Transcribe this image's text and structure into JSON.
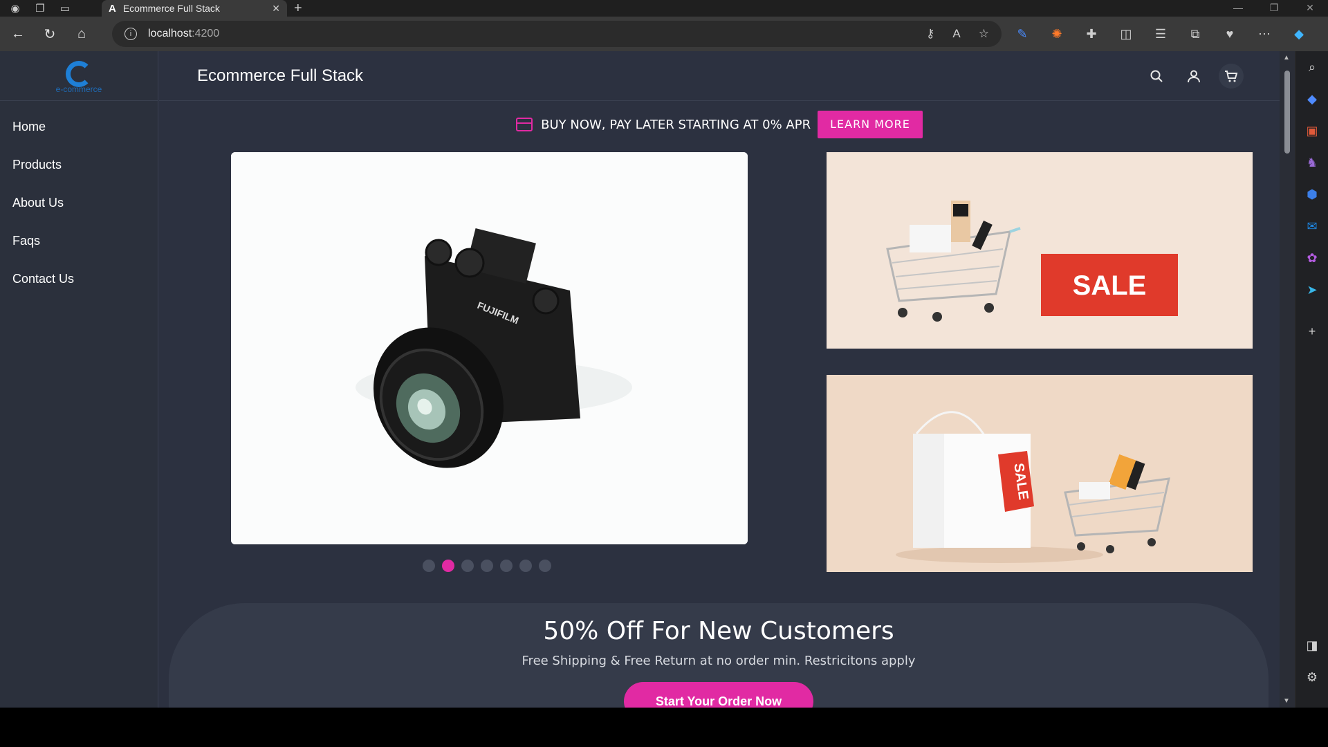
{
  "browser": {
    "tab_title": "Ecommerce Full Stack",
    "tab_favicon": "A",
    "url_host": "localhost",
    "url_port": ":4200"
  },
  "site": {
    "brand_title": "Ecommerce Full Stack",
    "logo_text": "e-commerce",
    "nav": [
      "Home",
      "Products",
      "About Us",
      "Faqs",
      "Contact Us"
    ],
    "promo_text": "BUY NOW, PAY LATER STARTING AT 0% APR",
    "promo_button": "LEARN MORE",
    "carousel": {
      "slide_count": 7,
      "active_index": 1
    },
    "sale_banner_text": "SALE",
    "sale_tag_text": "SALE",
    "offer": {
      "heading": "50% Off For New Customers",
      "subtext": "Free Shipping & Free Return at no order min. Restricitons apply",
      "cta": "Start Your Order Now"
    }
  },
  "colors": {
    "accent": "#e12aa3",
    "page_bg": "#2c3140",
    "logo_blue": "#1e7fd6"
  }
}
